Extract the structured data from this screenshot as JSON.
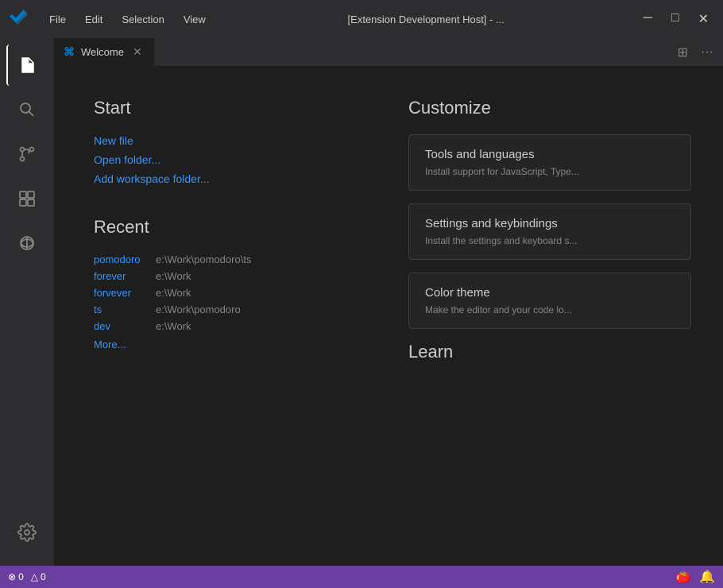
{
  "titleBar": {
    "title": "[Extension Development Host] - ...",
    "menuItems": [
      "File",
      "Edit",
      "Selection",
      "View"
    ],
    "controls": [
      "─",
      "□",
      "✕"
    ]
  },
  "activityBar": {
    "icons": [
      {
        "name": "explorer-icon",
        "symbol": "📄",
        "active": true
      },
      {
        "name": "search-icon",
        "symbol": "🔍"
      },
      {
        "name": "source-control-icon",
        "symbol": "⎇"
      },
      {
        "name": "extensions-icon",
        "symbol": "⊞"
      },
      {
        "name": "remote-icon",
        "symbol": "⚙"
      }
    ],
    "bottomIcons": [
      {
        "name": "gear-icon",
        "symbol": "⚙"
      }
    ]
  },
  "tabs": {
    "active": {
      "icon": "vs",
      "label": "Welcome",
      "closeable": true
    },
    "actions": {
      "split": "⊞",
      "more": "..."
    }
  },
  "welcome": {
    "left": {
      "start": {
        "title": "Start",
        "links": [
          {
            "label": "New file",
            "name": "new-file-link"
          },
          {
            "label": "Open folder...",
            "name": "open-folder-link"
          },
          {
            "label": "Add workspace folder...",
            "name": "add-workspace-link"
          }
        ]
      },
      "recent": {
        "title": "Recent",
        "items": [
          {
            "name": "pomodoro",
            "path": "e:\\Work\\pomodoro\\ts"
          },
          {
            "name": "forever",
            "path": "e:\\Work"
          },
          {
            "name": "forvever",
            "path": "e:\\Work"
          },
          {
            "name": "ts",
            "path": "e:\\Work\\pomodoro"
          },
          {
            "name": "dev",
            "path": "e:\\Work"
          }
        ],
        "moreLabel": "More..."
      }
    },
    "right": {
      "customize": {
        "title": "Customize",
        "cards": [
          {
            "title": "Tools and languages",
            "desc": "Install support for JavaScript, Type..."
          },
          {
            "title": "Settings and keybindings",
            "desc": "Install the settings and keyboard s..."
          },
          {
            "title": "Color theme",
            "desc": "Make the editor and your code lo..."
          }
        ]
      },
      "learn": {
        "title": "Learn"
      }
    }
  },
  "statusBar": {
    "left": [
      {
        "icon": "error-icon",
        "symbol": "⊗",
        "count": "0"
      },
      {
        "icon": "warning-icon",
        "symbol": "△",
        "count": "0"
      }
    ],
    "right": [
      {
        "icon": "tomato-icon",
        "symbol": "🍅"
      },
      {
        "icon": "bell-icon",
        "symbol": "🔔"
      }
    ]
  }
}
